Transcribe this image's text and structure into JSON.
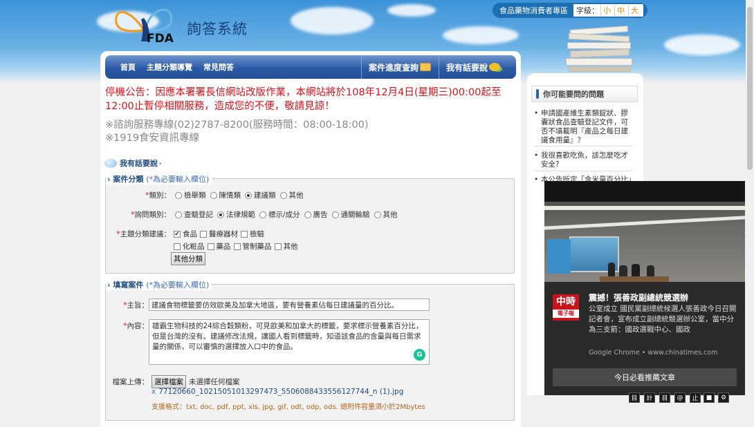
{
  "header": {
    "site_title": "詢答系統",
    "logo_text": "FDA",
    "consumer_zone": "食品藥物消費者專區",
    "font_size_label": "字級：",
    "font_sizes": [
      "小",
      "中",
      "大"
    ]
  },
  "nav": {
    "items": [
      "首頁",
      "主題分類導覽",
      "常見問答"
    ],
    "case_progress": "案件進度查詢",
    "speak_out": "我有話要說"
  },
  "notice": "停機公告：因應本署署長信網站改版作業，本網站將於108年12月4日(星期三)00:00起至12:00止暫停相關服務，造成您的不便，敬請見諒！",
  "hotline": {
    "line1": "※諮詢服務專線(02)2787-8200(服務時間：08:00-18:00)",
    "line2": "※1919食安資訊專線"
  },
  "section_title": "我有話要說",
  "case_category": {
    "legend": "案件分類",
    "required_note": "(*為必要輸入欄位)",
    "type": {
      "label": "類別：",
      "options": [
        "檢舉類",
        "陳情類",
        "建議類",
        "其他"
      ],
      "selected": 2
    },
    "inquiry_type": {
      "label": "詢問類別：",
      "options": [
        "查驗登記",
        "法律規範",
        "標示/成分",
        "廣告",
        "通關輸驗",
        "其他"
      ],
      "selected": 1
    },
    "topic": {
      "label": "主題分類建議：",
      "row1": [
        "食品",
        "醫療器材",
        "檢驗"
      ],
      "row2": [
        "化粧品",
        "藥品",
        "管制藥品",
        "其他"
      ],
      "checked": [
        "食品"
      ],
      "other_button": "其他分類"
    }
  },
  "case_fill": {
    "legend": "填寫案件",
    "required_note": "(*為必要輸入欄位)",
    "subject_label": "主旨：",
    "subject_value": "建議食物標籤要仿效歐美及加拿大地區，要有營養素佔每日建議量的百分比。",
    "content_label": "內容：",
    "content_value": "雄霸生物科技的24綜合穀類粉，可見歐美和加拿大的標籤，要求標示營養素百分比，但是台灣的沒有。建議修改法規，讓國人看到標籤時，知道該食品的含量與每日需求量的關係，可以審慎的選擇放入口中的食品。",
    "upload_label": "檔案上傳：",
    "choose_file": "選擇檔案",
    "no_file": "未選擇任何檔案",
    "attached_file": "77120660_10215051013297473_5506088433556127744_n (1).jpg",
    "remove_mark": "x",
    "formats": "支援格式：txt, doc, pdf, ppt, xls, jpg, gif, odt, odp, ods. 總附件容量須小於2Mbytes"
  },
  "sidebar": {
    "title": "你可能要問的問題",
    "items": [
      "申請國產維生素類錠狀、膠囊狀食品查驗登記文件，可否不填載明『產品之每日建議食用量』？",
      "我很喜歡吃魚，該怎麼吃才安全?",
      "本公告所定「含米量百分比」"
    ]
  },
  "popup": {
    "logo_line1": "中時",
    "logo_line2": "電子報",
    "headline": "震撼！張善政副總統競選辦",
    "body": "公室成立 國民黨副總統候選人張善政今日召開記者會，宣布成立副總統競選辦公室，當中分為三支箭：國政選戰中心、國政",
    "source": "Google Chrome • www.chinatimes.com",
    "button": "今日必看推薦文章"
  },
  "share_icons": [
    "目",
    "計",
    "目",
    "@",
    "止",
    "■",
    "⚙"
  ]
}
